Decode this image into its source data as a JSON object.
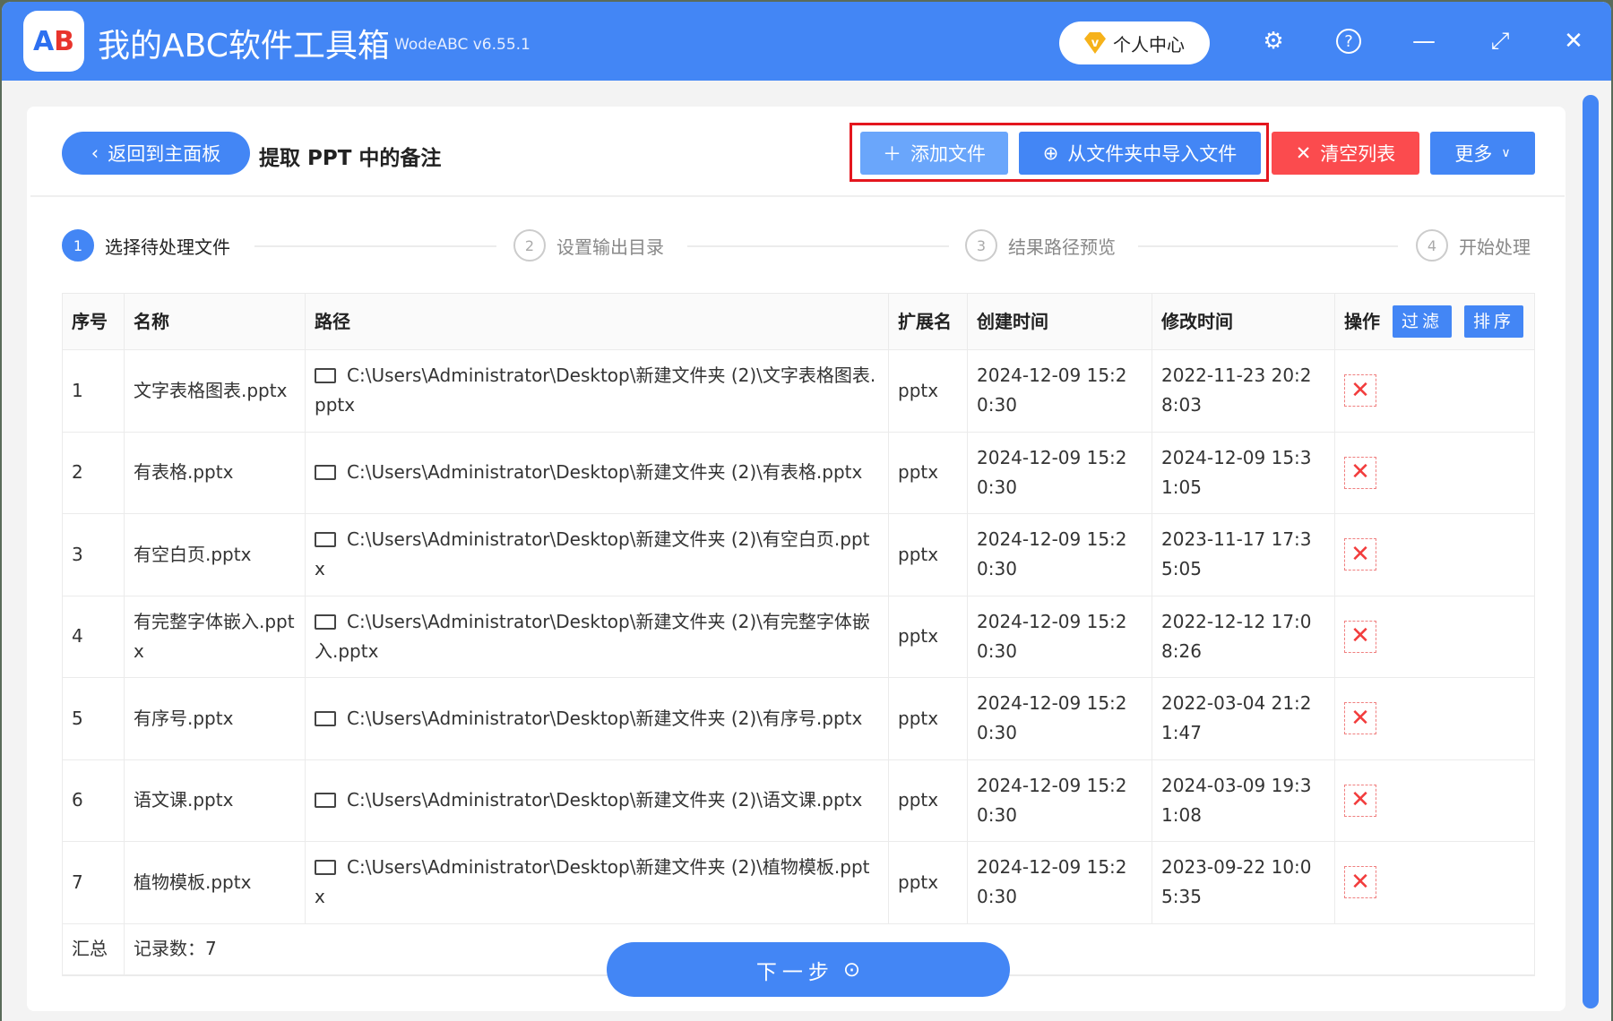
{
  "app": {
    "title": "我的ABC软件工具箱",
    "version": "WodeABC v6.55.1",
    "logo_text": "AB",
    "user_center": "个人中心"
  },
  "header": {
    "back": "返回到主面板",
    "page_title": "提取 PPT 中的备注",
    "add_file": "添加文件",
    "import_folder": "从文件夹中导入文件",
    "clear_list": "清空列表",
    "more": "更多"
  },
  "steps": [
    {
      "num": "1",
      "label": "选择待处理文件"
    },
    {
      "num": "2",
      "label": "设置输出目录"
    },
    {
      "num": "3",
      "label": "结果路径预览"
    },
    {
      "num": "4",
      "label": "开始处理"
    }
  ],
  "table": {
    "headers": [
      "序号",
      "名称",
      "路径",
      "扩展名",
      "创建时间",
      "修改时间",
      "操作"
    ],
    "filter": "过滤",
    "sort": "排序",
    "rows": [
      {
        "no": "1",
        "name": "文字表格图表.pptx",
        "path": "C:\\Users\\Administrator\\Desktop\\新建文件夹 (2)\\文字表格图表.pptx",
        "ext": "pptx",
        "created": "2024-12-09 15:20:30",
        "modified": "2022-11-23 20:28:03"
      },
      {
        "no": "2",
        "name": "有表格.pptx",
        "path": "C:\\Users\\Administrator\\Desktop\\新建文件夹 (2)\\有表格.pptx",
        "ext": "pptx",
        "created": "2024-12-09 15:20:30",
        "modified": "2024-12-09 15:31:05"
      },
      {
        "no": "3",
        "name": "有空白页.pptx",
        "path": "C:\\Users\\Administrator\\Desktop\\新建文件夹 (2)\\有空白页.pptx",
        "ext": "pptx",
        "created": "2024-12-09 15:20:30",
        "modified": "2023-11-17 17:35:05"
      },
      {
        "no": "4",
        "name": "有完整字体嵌入.pptx",
        "path": "C:\\Users\\Administrator\\Desktop\\新建文件夹 (2)\\有完整字体嵌入.pptx",
        "ext": "pptx",
        "created": "2024-12-09 15:20:30",
        "modified": "2022-12-12 17:08:26"
      },
      {
        "no": "5",
        "name": "有序号.pptx",
        "path": "C:\\Users\\Administrator\\Desktop\\新建文件夹 (2)\\有序号.pptx",
        "ext": "pptx",
        "created": "2024-12-09 15:20:30",
        "modified": "2022-03-04 21:21:47"
      },
      {
        "no": "6",
        "name": "语文课.pptx",
        "path": "C:\\Users\\Administrator\\Desktop\\新建文件夹 (2)\\语文课.pptx",
        "ext": "pptx",
        "created": "2024-12-09 15:20:30",
        "modified": "2024-03-09 19:31:08"
      },
      {
        "no": "7",
        "name": "植物模板.pptx",
        "path": "C:\\Users\\Administrator\\Desktop\\新建文件夹 (2)\\植物模板.pptx",
        "ext": "pptx",
        "created": "2024-12-09 15:20:30",
        "modified": "2023-09-22 10:05:35"
      }
    ],
    "summary_label": "汇总",
    "summary_count": "记录数：7"
  },
  "next": "下一步"
}
